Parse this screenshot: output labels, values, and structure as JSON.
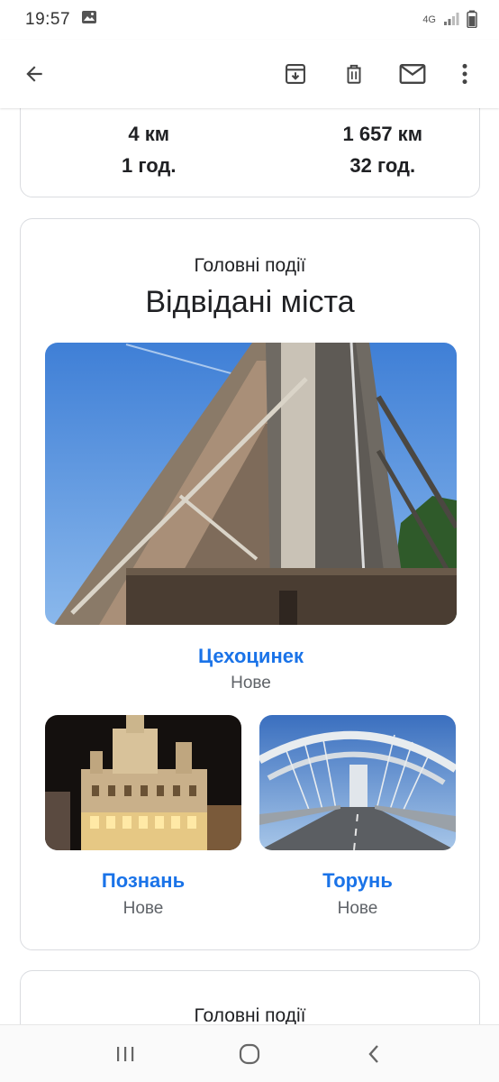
{
  "status_bar": {
    "time": "19:57",
    "network": "4G",
    "icons": [
      "image-icon",
      "network-4g-icon",
      "signal-icon",
      "battery-icon"
    ]
  },
  "toolbar": {
    "icons": [
      "back-arrow-icon",
      "archive-icon",
      "delete-icon",
      "mark-unread-icon",
      "more-vert-icon"
    ]
  },
  "stats_card": {
    "left_distance": "4 км",
    "left_time": "1 год.",
    "right_distance": "1 657 км",
    "right_time": "32 год."
  },
  "cities_card": {
    "subtitle": "Головні події",
    "title": "Відвідані міста",
    "featured": {
      "name": "Цехоцинек",
      "status": "Нове"
    },
    "cities": [
      {
        "name": "Познань",
        "status": "Нове"
      },
      {
        "name": "Торунь",
        "status": "Нове"
      }
    ]
  },
  "next_card": {
    "subtitle": "Головні події"
  },
  "nav_bar": {
    "icons": [
      "recents-icon",
      "home-icon",
      "back-icon"
    ]
  },
  "colors": {
    "link_blue": "#1a73e8",
    "secondary_text": "#5f6368",
    "card_border": "#dadce0"
  }
}
